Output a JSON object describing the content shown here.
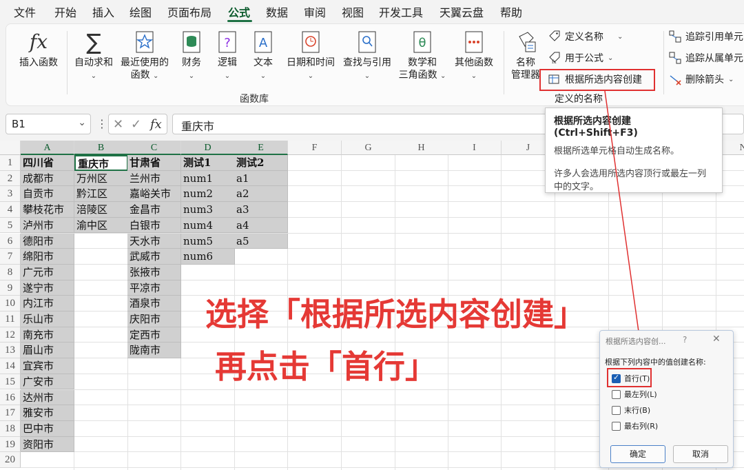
{
  "menu": [
    "文件",
    "开始",
    "插入",
    "绘图",
    "页面布局",
    "公式",
    "数据",
    "审阅",
    "视图",
    "开发工具",
    "天翼云盘",
    "帮助"
  ],
  "ribbon": {
    "insert_function": "插入函数",
    "autosum": "自动求和",
    "recent": [
      "最近使用的",
      "函数"
    ],
    "financial": "财务",
    "logical": "逻辑",
    "text": "文本",
    "datetime": "日期和时间",
    "lookup": "查找与引用",
    "math": [
      "数学和",
      "三角函数"
    ],
    "other": "其他函数",
    "group_label": "函数库",
    "name_manager": [
      "名称",
      "管理器"
    ],
    "define_name": "定义名称",
    "use_in_formula": "用于公式",
    "create_from_selection": "根据所选内容创建",
    "defined_names_group": "定义的名称",
    "trace_precedents": "追踪引用单元",
    "trace_dependents": "追踪从属单元",
    "remove_arrows": "删除箭头",
    "fx_symbol": "fx",
    "sigma_symbol": "∑"
  },
  "formula_bar": {
    "name_box": "B1",
    "content": "重庆市",
    "fx": "fx"
  },
  "grid": {
    "columns": [
      "A",
      "B",
      "C",
      "D",
      "E",
      "F",
      "G",
      "H",
      "I",
      "J",
      "K",
      "L",
      "M",
      "N"
    ],
    "rows": [
      "1",
      "2",
      "3",
      "4",
      "5",
      "6",
      "7",
      "8",
      "9",
      "10",
      "11",
      "12",
      "13",
      "14",
      "15",
      "16",
      "17",
      "18",
      "19",
      "20"
    ],
    "colA": [
      "四川省",
      "成都市",
      "自贡市",
      "攀枝花市",
      "泸州市",
      "德阳市",
      "绵阳市",
      "广元市",
      "遂宁市",
      "内江市",
      "乐山市",
      "南充市",
      "眉山市",
      "宜宾市",
      "广安市",
      "达州市",
      "雅安市",
      "巴中市",
      "资阳市"
    ],
    "colB": [
      "重庆市",
      "万州区",
      "黔江区",
      "涪陵区",
      "渝中区"
    ],
    "colC": [
      "甘肃省",
      "兰州市",
      "嘉峪关市",
      "金昌市",
      "白银市",
      "天水市",
      "武威市",
      "张掖市",
      "平凉市",
      "酒泉市",
      "庆阳市",
      "定西市",
      "陇南市"
    ],
    "colD": [
      "测试1",
      "num1",
      "num2",
      "num3",
      "num4",
      "num5",
      "num6"
    ],
    "colE": [
      "测试2",
      "a1",
      "a2",
      "a3",
      "a4",
      "a5"
    ]
  },
  "tooltip": {
    "title": "根据所选内容创建 (Ctrl+Shift+F3)",
    "line1": "根据所选单元格自动生成名称。",
    "line2": "许多人会选用所选内容顶行或最左一列中的文字。"
  },
  "annotation": {
    "line1": "选择「根据所选内容创建」",
    "line2": "再点击「首行」"
  },
  "dialog": {
    "title": "根据所选内容创...",
    "help": "?",
    "close": "✕",
    "prompt": "根据下列内容中的值创建名称:",
    "options": [
      {
        "label": "首行(T)",
        "checked": true
      },
      {
        "label": "最左列(L)",
        "checked": false
      },
      {
        "label": "末行(B)",
        "checked": false
      },
      {
        "label": "最右列(R)",
        "checked": false
      }
    ],
    "ok": "确定",
    "cancel": "取消"
  },
  "colors": {
    "accent": "#1e7145",
    "annotation": "#e53935",
    "selection_gray": "#d0d0d0"
  }
}
